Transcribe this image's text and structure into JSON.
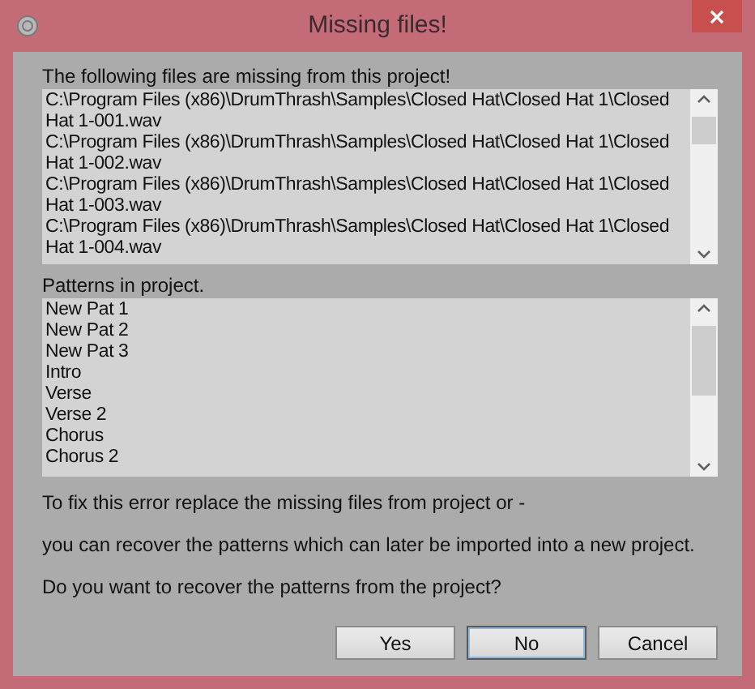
{
  "window": {
    "title": "Missing files!"
  },
  "missing_files": {
    "label": "The following files are missing from this project!",
    "items": [
      "C:\\Program Files (x86)\\DrumThrash\\Samples\\Closed Hat\\Closed Hat 1\\Closed Hat 1-001.wav",
      "C:\\Program Files (x86)\\DrumThrash\\Samples\\Closed Hat\\Closed Hat 1\\Closed Hat 1-002.wav",
      "C:\\Program Files (x86)\\DrumThrash\\Samples\\Closed Hat\\Closed Hat 1\\Closed Hat 1-003.wav",
      "C:\\Program Files (x86)\\DrumThrash\\Samples\\Closed Hat\\Closed Hat 1\\Closed Hat 1-004.wav"
    ]
  },
  "patterns": {
    "label": "Patterns in project.",
    "items": [
      "New Pat 1",
      "New Pat 2",
      "New Pat 3",
      "Intro",
      "Verse",
      "Verse 2",
      "Chorus",
      "Chorus 2"
    ]
  },
  "messages": [
    "To fix this error replace the missing files from project or -",
    "you can recover the patterns which can later be imported into a new project.",
    "Do you want to recover the patterns from the project?"
  ],
  "buttons": [
    {
      "label": "Yes",
      "default": false
    },
    {
      "label": "No",
      "default": true
    },
    {
      "label": "Cancel",
      "default": false
    }
  ]
}
